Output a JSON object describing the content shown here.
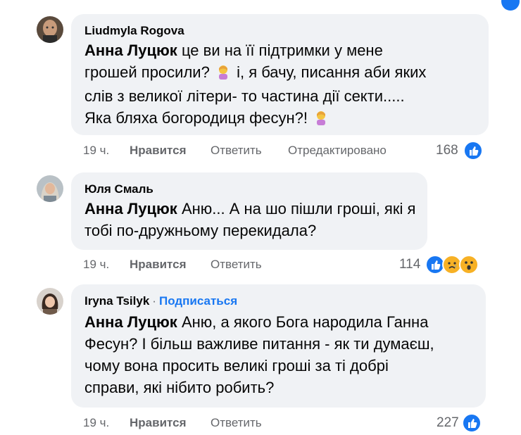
{
  "comments": [
    {
      "author": "Liudmyla Rogova",
      "mention": "Анна Луцюк",
      "lines": [
        "це ви на її підтримки у мене",
        "грошей просили?",
        "і, я бачу, писання аби яких",
        "слів з великої літери- то частина дії секти.....",
        "Яка бляха богородиця фесун?!"
      ],
      "time": "19 ч.",
      "like_label": "Нравится",
      "reply_label": "Ответить",
      "edited_label": "Отредактировано",
      "reaction_count": "168",
      "reactions": [
        "like"
      ]
    },
    {
      "author": "Юля Смаль",
      "mention": "Анна Луцюк",
      "lines": [
        "Аню... А на шо пішли гроші, які я",
        "тобі по-дружньому перекидала?"
      ],
      "time": "19 ч.",
      "like_label": "Нравится",
      "reply_label": "Ответить",
      "reaction_count": "114",
      "reactions": [
        "like",
        "sad",
        "wow"
      ]
    },
    {
      "author": "Iryna Tsilyk",
      "follow_label": "Подписаться",
      "mention": "Анна Луцюк",
      "lines": [
        "Аню, а якого Бога народила Ганна",
        "Фесун? І більш важливе питання - як ти думаєш,",
        "чому вона просить великі гроші за ті добрі",
        "справи, які нібито робить?"
      ],
      "time": "19 ч.",
      "like_label": "Нравится",
      "reply_label": "Ответить",
      "reaction_count": "227",
      "reactions": [
        "like"
      ]
    }
  ],
  "colors": {
    "bubble": "#f0f2f5",
    "link": "#1877f2",
    "secondary": "#65676b",
    "like": "#1877f2",
    "emoji": "#f7b125"
  },
  "emoji_icons": [
    "person-facepalming-icon"
  ]
}
